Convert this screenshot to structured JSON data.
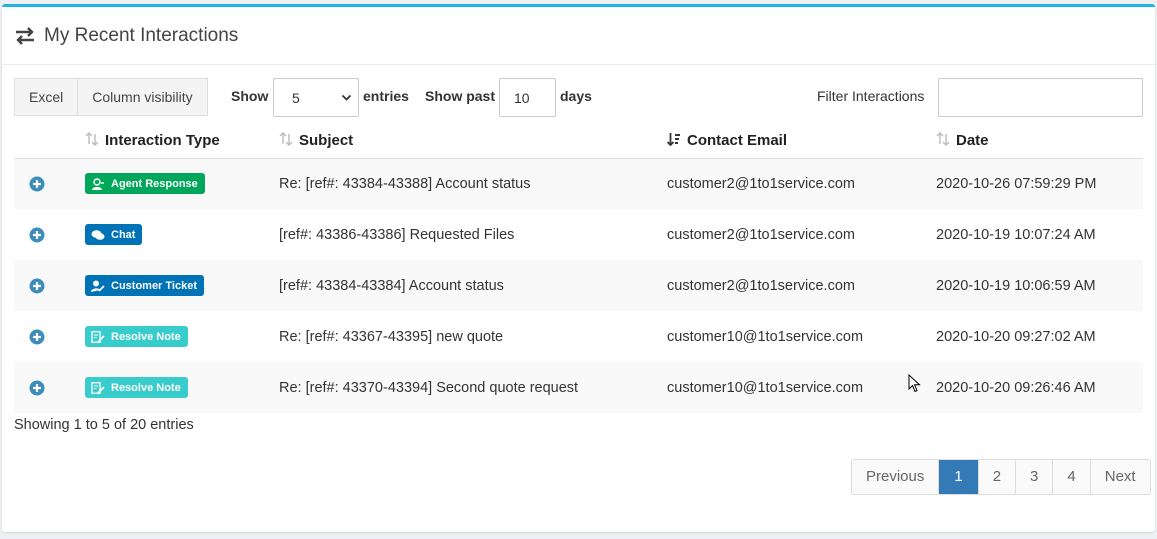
{
  "panel": {
    "title": "My Recent Interactions"
  },
  "toolbar": {
    "excel_label": "Excel",
    "column_visibility_label": "Column visibility",
    "show_label": "Show",
    "entries_value": "5",
    "entries_label": "entries",
    "show_past_label": "Show past",
    "days_value": "10",
    "days_label": "days",
    "filter_label": "Filter Interactions",
    "filter_value": ""
  },
  "table": {
    "headers": [
      "Interaction Type",
      "Subject",
      "Contact Email",
      "Date"
    ],
    "rows": [
      {
        "type": "Agent Response",
        "subject": "Re: [ref#: 43384-43388] Account status",
        "email": "customer2@1to1service.com",
        "date": "2020-10-26 07:59:29 PM"
      },
      {
        "type": "Chat",
        "subject": "[ref#: 43386-43386] Requested Files",
        "email": "customer2@1to1service.com",
        "date": "2020-10-19 10:07:24 AM"
      },
      {
        "type": "Customer Ticket",
        "subject": "[ref#: 43384-43384] Account status",
        "email": "customer2@1to1service.com",
        "date": "2020-10-19 10:06:59 AM"
      },
      {
        "type": "Resolve Note",
        "subject": "Re: [ref#: 43367-43395] new quote",
        "email": "customer10@1to1service.com",
        "date": "2020-10-20 09:27:02 AM"
      },
      {
        "type": "Resolve Note",
        "subject": "Re: [ref#: 43370-43394] Second quote request",
        "email": "customer10@1to1service.com",
        "date": "2020-10-20 09:26:46 AM"
      }
    ]
  },
  "info": "Showing 1 to 5 of 20 entries",
  "pagination": {
    "previous": "Previous",
    "pages": [
      "1",
      "2",
      "3",
      "4"
    ],
    "next": "Next"
  },
  "colors": {
    "accent_top": "#1eb5e6",
    "link": "#3c8dbc",
    "agent_badge": "#00a65a",
    "chat_badge": "#0073b7",
    "ticket_badge": "#0073b7",
    "resolve_badge": "#39cccc",
    "page_active": "#337ab7"
  },
  "icons": {
    "header": "exchange-arrows-icon",
    "expand": "plus-circle-icon",
    "sort": "sort-arrows-icon",
    "sort_active": "sort-amount-down-icon"
  }
}
